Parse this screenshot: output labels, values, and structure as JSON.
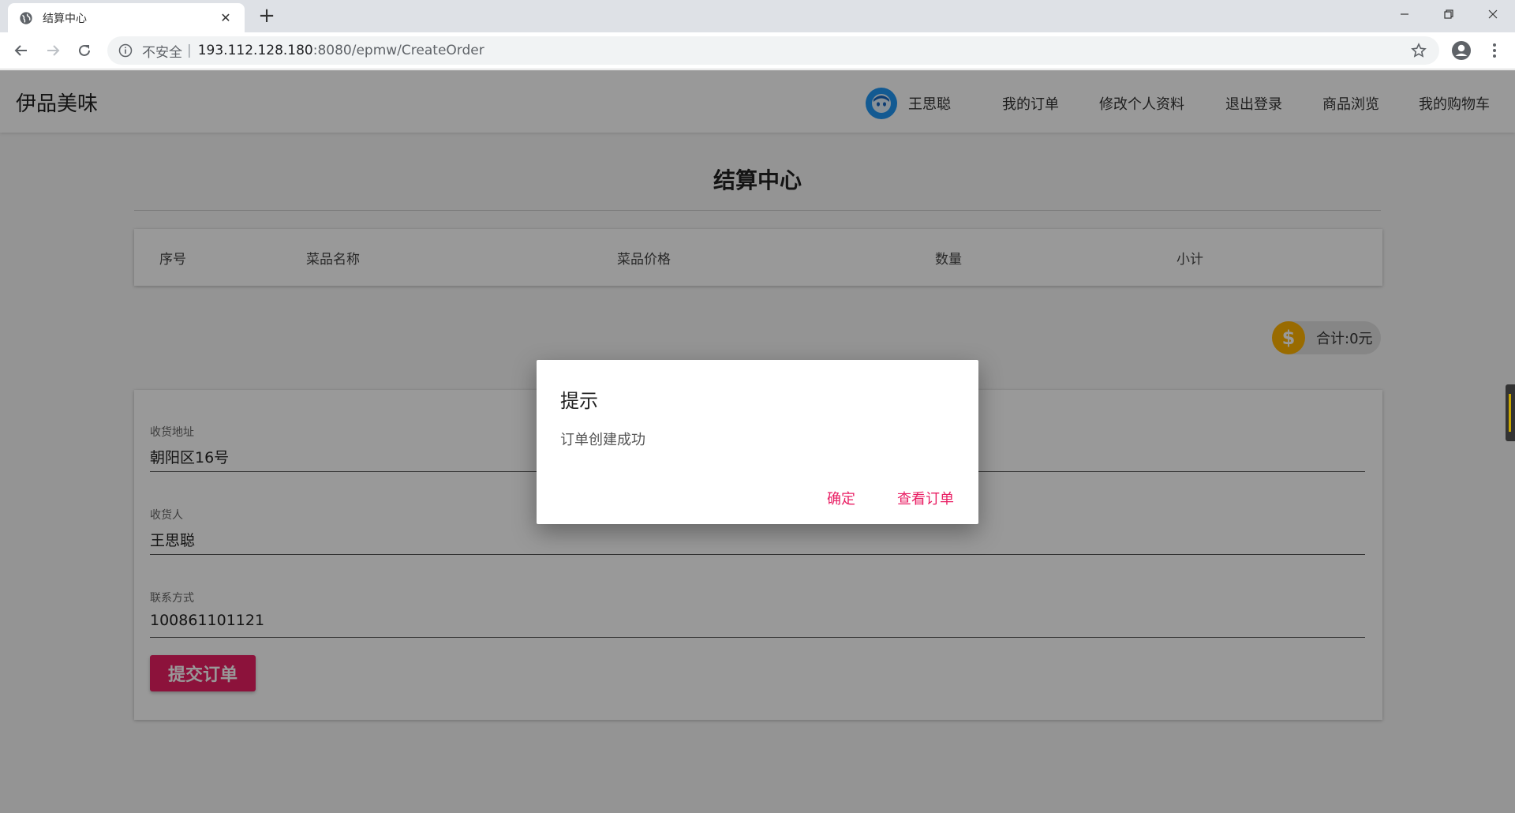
{
  "browser": {
    "tab_title": "结算中心",
    "omnibox": {
      "insecure_label": "不安全",
      "separator": "|",
      "host": "193.112.128.180",
      "path": ":8080/epmw/CreateOrder"
    }
  },
  "header": {
    "brand": "伊品美味",
    "user_name": "王思聪",
    "nav": {
      "orders": "我的订单",
      "profile": "修改个人资料",
      "logout": "退出登录",
      "browse": "商品浏览",
      "cart": "我的购物车"
    }
  },
  "main": {
    "title": "结算中心",
    "table": {
      "columns": [
        "序号",
        "菜品名称",
        "菜品价格",
        "数量",
        "小计"
      ]
    },
    "total": {
      "coin_symbol": "$",
      "label": "合计:0元"
    },
    "form": {
      "address_label": "收货地址",
      "address_value": "朝阳区16号",
      "receiver_label": "收货人",
      "receiver_value": "王思聪",
      "contact_label": "联系方式",
      "contact_value": "100861101121",
      "submit_label": "提交订单"
    }
  },
  "dialog": {
    "title": "提示",
    "message": "订单创建成功",
    "confirm_label": "确定",
    "view_orders_label": "查看订单"
  },
  "colors": {
    "accent": "#e91e63",
    "avatar": "#2196f3",
    "coin": "#ffb300"
  }
}
